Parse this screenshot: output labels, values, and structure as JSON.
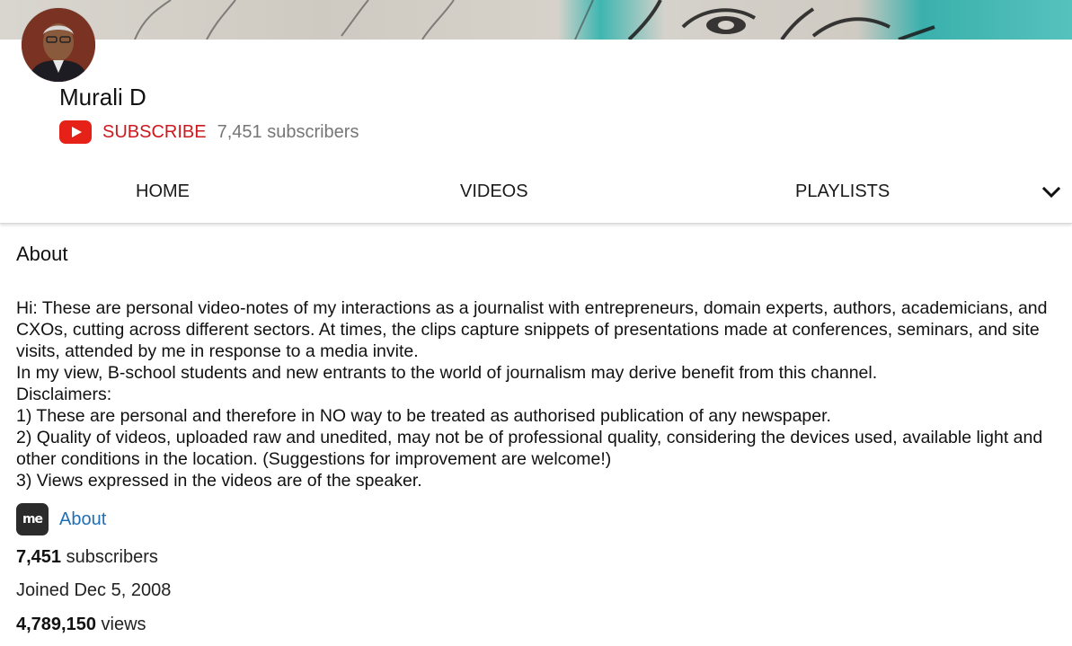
{
  "channel": {
    "name": "Murali D",
    "subscribe_label": "SUBSCRIBE",
    "subscriber_count_text": "7,451 subscribers"
  },
  "tabs": [
    {
      "label": "HOME"
    },
    {
      "label": "VIDEOS"
    },
    {
      "label": "PLAYLISTS"
    }
  ],
  "about": {
    "heading": "About",
    "description_lines": [
      "Hi: These are personal video-notes of my interactions as a journalist with entrepreneurs, domain experts, authors, academicians, and CXOs, cutting across different sectors. At times, the clips capture snippets of presentations made at conferences, seminars, and site visits, attended by me in response to a media invite.",
      "In my view, B-school students and new entrants to the world of journalism may derive benefit from this channel.",
      "Disclaimers:",
      "1) These are personal and therefore in NO way to be treated as authorised publication of any newspaper.",
      "2) Quality of videos, uploaded raw and unedited, may not be of professional quality, considering the devices used, available light and other conditions in the location. (Suggestions for improvement are welcome!)",
      "3) Views expressed in the videos are of the speaker."
    ],
    "link_icon_text": "me",
    "link_label": "About"
  },
  "stats": {
    "subscribers_value": "7,451",
    "subscribers_suffix": " subscribers",
    "joined": "Joined Dec 5, 2008",
    "views_value": "4,789,150",
    "views_suffix": " views"
  },
  "icons": {
    "logo": "youtube-logo-icon",
    "more": "chevron-down-icon",
    "link": "me-icon"
  },
  "colors": {
    "subscribe": "#cc181e",
    "youtube_red": "#e62117",
    "link": "#1f6fb5"
  }
}
